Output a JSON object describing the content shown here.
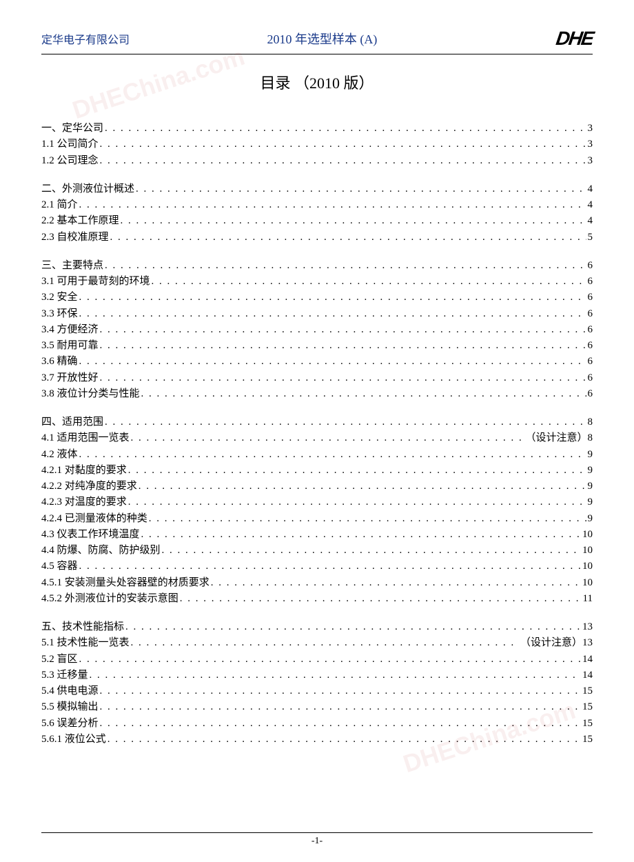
{
  "header": {
    "company": "定华电子有限公司",
    "doc_title": "2010 年选型样本  (A)",
    "logo": "DHE"
  },
  "toc_title": "目录 （2010 版）",
  "page_number": "-1-",
  "watermark": "DHEChina.com",
  "sections": [
    {
      "rows": [
        {
          "label": "一、定华公司",
          "note": "",
          "page": "3"
        },
        {
          "label": "1.1 公司简介",
          "note": "",
          "page": "3"
        },
        {
          "label": "1.2 公司理念",
          "note": "",
          "page": "3"
        }
      ]
    },
    {
      "rows": [
        {
          "label": "二、外测液位计概述",
          "note": "",
          "page": "4"
        },
        {
          "label": "2.1 简介",
          "note": "",
          "page": "4"
        },
        {
          "label": "2.2 基本工作原理",
          "note": "",
          "page": "4"
        },
        {
          "label": "2.3 自校准原理",
          "note": "",
          "page": "5"
        }
      ]
    },
    {
      "rows": [
        {
          "label": "三、主要特点",
          "note": "",
          "page": "6"
        },
        {
          "label": "3.1 可用于最苛刻的环境",
          "note": "",
          "page": "6"
        },
        {
          "label": "3.2 安全",
          "note": "",
          "page": "6"
        },
        {
          "label": "3.3 环保",
          "note": "",
          "page": "6"
        },
        {
          "label": "3.4 方便经济",
          "note": "",
          "page": "6"
        },
        {
          "label": "3.5 耐用可靠",
          "note": "",
          "page": "6"
        },
        {
          "label": "3.6 精确",
          "note": "",
          "page": "6"
        },
        {
          "label": "3.7 开放性好",
          "note": "",
          "page": "6"
        },
        {
          "label": "3.8 液位计分类与性能",
          "note": "",
          "page": "6"
        }
      ]
    },
    {
      "rows": [
        {
          "label": "四、适用范围",
          "note": "",
          "page": "8"
        },
        {
          "label": "4.1 适用范围一览表",
          "note": "（设计注意）",
          "page": "8"
        },
        {
          "label": "4.2 液体",
          "note": "",
          "page": "9"
        },
        {
          "label": "4.2.1 对黏度的要求",
          "note": "",
          "page": "9"
        },
        {
          "label": "4.2.2 对纯净度的要求",
          "note": "",
          "page": "9"
        },
        {
          "label": "4.2.3 对温度的要求",
          "note": "",
          "page": "9"
        },
        {
          "label": "4.2.4 已测量液体的种类",
          "note": "",
          "page": "9"
        },
        {
          "label": "4.3 仪表工作环境温度",
          "note": "",
          "page": "10"
        },
        {
          "label": "4.4 防爆、防腐、防护级别",
          "note": "",
          "page": "10"
        },
        {
          "label": "4.5 容器",
          "note": "",
          "page": "10"
        },
        {
          "label": "4.5.1 安装测量头处容器壁的材质要求",
          "note": "",
          "page": "10"
        },
        {
          "label": "4.5.2 外测液位计的安装示意图",
          "note": "",
          "page": "11"
        }
      ]
    },
    {
      "rows": [
        {
          "label": "五、技术性能指标",
          "note": "",
          "page": "13"
        },
        {
          "label": "5.1 技术性能一览表",
          "note": "（设计注意）",
          "page": "13"
        },
        {
          "label": "5.2 盲区",
          "note": "",
          "page": "14"
        },
        {
          "label": "5.3 迁移量",
          "note": "",
          "page": "14"
        },
        {
          "label": "5.4 供电电源",
          "note": "",
          "page": "15"
        },
        {
          "label": "5.5 模拟输出",
          "note": "",
          "page": "15"
        },
        {
          "label": "5.6 误差分析",
          "note": "",
          "page": "15"
        },
        {
          "label": "5.6.1 液位公式",
          "note": "",
          "page": "15"
        }
      ]
    }
  ]
}
